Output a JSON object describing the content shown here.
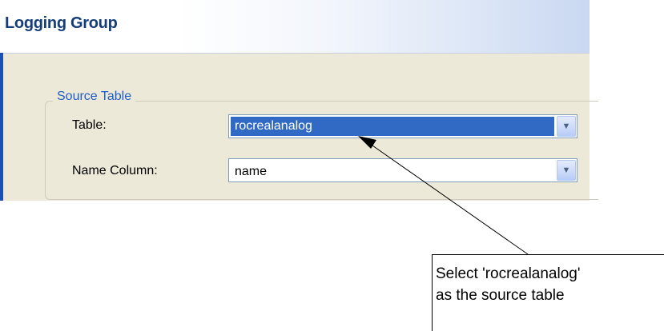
{
  "window": {
    "title": "Logging Group"
  },
  "group": {
    "title": "Source Table"
  },
  "fields": {
    "table": {
      "label": "Table:",
      "value": "rocrealanalog"
    },
    "name_column": {
      "label": "Name Column:",
      "value": "name"
    }
  },
  "icons": {
    "dropdown": "chevron-down-icon"
  },
  "callout": {
    "line1": "Select 'rocrealanalog'",
    "line2": "as the source table"
  },
  "colors": {
    "selection": "#316ac5",
    "group_title": "#1f5ec6",
    "window_title": "#153d7a"
  }
}
